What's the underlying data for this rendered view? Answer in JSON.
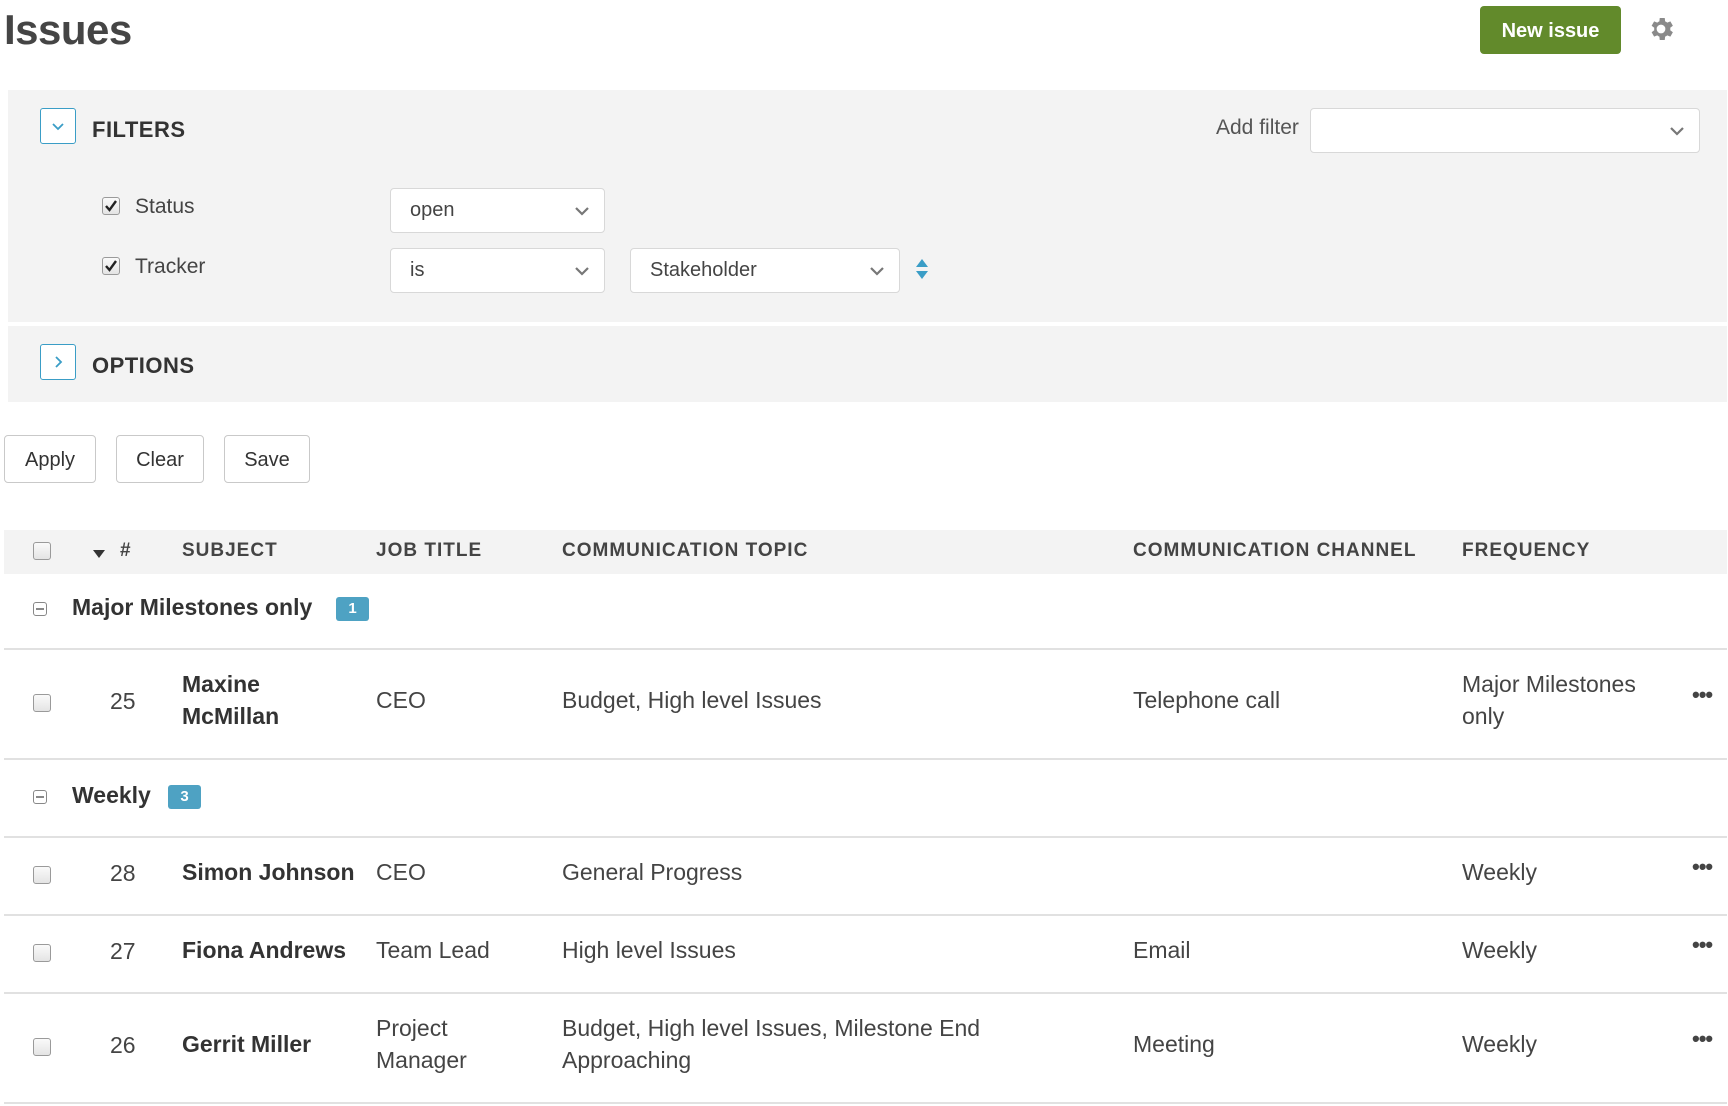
{
  "header": {
    "title": "Issues",
    "new_issue_label": "New issue"
  },
  "filters": {
    "title": "FILTERS",
    "add_filter_label": "Add filter",
    "add_filter_value": "",
    "rows": [
      {
        "label": "Status",
        "checked": true,
        "operator": "open"
      },
      {
        "label": "Tracker",
        "checked": true,
        "operator": "is",
        "value": "Stakeholder"
      }
    ]
  },
  "options": {
    "title": "OPTIONS"
  },
  "actions": {
    "apply": "Apply",
    "clear": "Clear",
    "save": "Save"
  },
  "table": {
    "columns": [
      "#",
      "SUBJECT",
      "JOB TITLE",
      "COMMUNICATION TOPIC",
      "COMMUNICATION CHANNEL",
      "FREQUENCY"
    ],
    "groups": [
      {
        "name": "Major Milestones only",
        "count": "1",
        "rows": [
          {
            "id": "25",
            "subject_line1": "Maxine",
            "subject_line2": "McMillan",
            "job_title": "CEO",
            "topic": "Budget, High level Issues",
            "channel": "Telephone call",
            "frequency_line1": "Major Milestones",
            "frequency_line2": "only"
          }
        ]
      },
      {
        "name": "Weekly",
        "count": "3",
        "rows": [
          {
            "id": "28",
            "subject": "Simon Johnson",
            "job_title": "CEO",
            "topic": "General Progress",
            "channel": "",
            "frequency": "Weekly"
          },
          {
            "id": "27",
            "subject": "Fiona Andrews",
            "job_title": "Team Lead",
            "topic": "High level Issues",
            "channel": "Email",
            "frequency": "Weekly"
          },
          {
            "id": "26",
            "subject": "Gerrit Miller",
            "job_title_line1": "Project",
            "job_title_line2": "Manager",
            "topic_line1": "Budget, High level Issues, Milestone End",
            "topic_line2": "Approaching",
            "channel": "Meeting",
            "frequency": "Weekly"
          }
        ]
      }
    ],
    "row_menu": "•••"
  },
  "colors": {
    "primary_button": "#628a2b",
    "accent": "#3a9dc6",
    "badge": "#4ea2c3"
  }
}
